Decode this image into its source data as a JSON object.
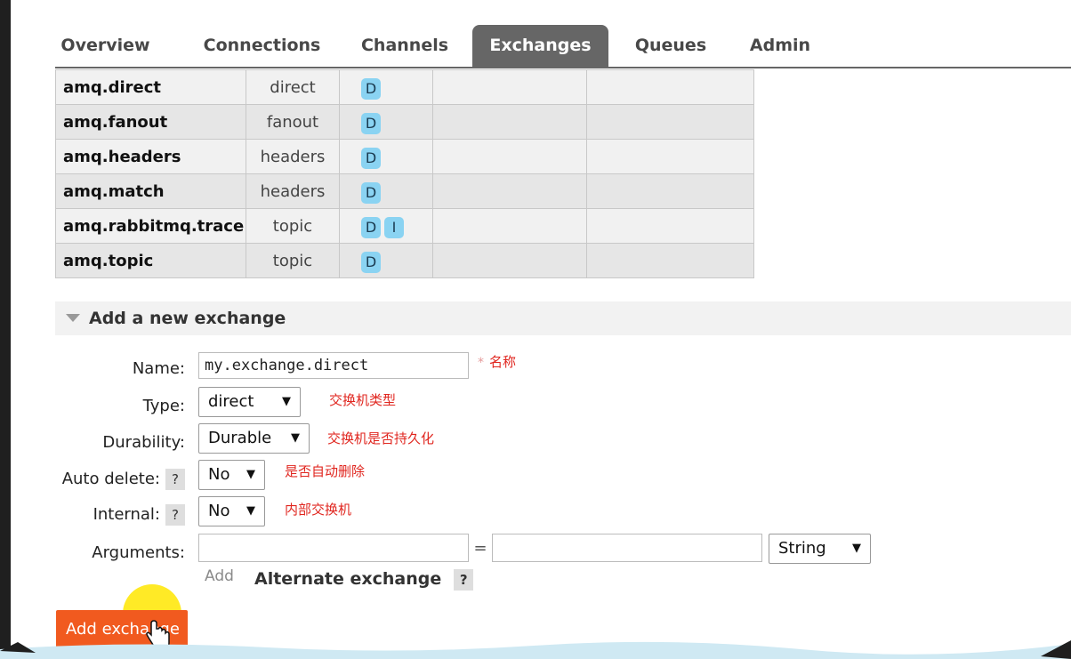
{
  "tabs": [
    {
      "label": "Overview"
    },
    {
      "label": "Connections"
    },
    {
      "label": "Channels"
    },
    {
      "label": "Exchanges",
      "active": true
    },
    {
      "label": "Queues"
    },
    {
      "label": "Admin"
    }
  ],
  "exchanges": [
    {
      "name": "amq.direct",
      "type": "direct",
      "features": [
        "D"
      ]
    },
    {
      "name": "amq.fanout",
      "type": "fanout",
      "features": [
        "D"
      ]
    },
    {
      "name": "amq.headers",
      "type": "headers",
      "features": [
        "D"
      ]
    },
    {
      "name": "amq.match",
      "type": "headers",
      "features": [
        "D"
      ]
    },
    {
      "name": "amq.rabbitmq.trace",
      "type": "topic",
      "features": [
        "D",
        "I"
      ]
    },
    {
      "name": "amq.topic",
      "type": "topic",
      "features": [
        "D"
      ]
    }
  ],
  "add_section": {
    "title": "Add a new exchange"
  },
  "form": {
    "name_label": "Name:",
    "name_value": "my.exchange.direct",
    "name_required": "*",
    "type_label": "Type:",
    "type_value": "direct",
    "durability_label": "Durability:",
    "durability_value": "Durable",
    "auto_delete_label": "Auto delete:",
    "auto_delete_value": "No",
    "internal_label": "Internal:",
    "internal_value": "No",
    "arguments_label": "Arguments:",
    "equals": "=",
    "arg_type_value": "String",
    "help": "?",
    "add_link": "Add",
    "alternate_exchange": "Alternate exchange",
    "submit": "Add exchange"
  },
  "annotations": {
    "name": "名称",
    "type": "交换机类型",
    "durability": "交换机是否持久化",
    "auto_delete": "是否自动删除",
    "internal": "内部交换机"
  },
  "colors": {
    "tab_active_bg": "#666666",
    "badge_bg": "#8ad3f2",
    "submit_bg": "#f15a1f",
    "annotation": "#e0261f",
    "cursor_highlight": "#ffe600"
  },
  "icons": {
    "collapse": "triangle-down-icon",
    "select": "dropdown-arrow-icon",
    "cursor": "hand-pointer-icon"
  }
}
